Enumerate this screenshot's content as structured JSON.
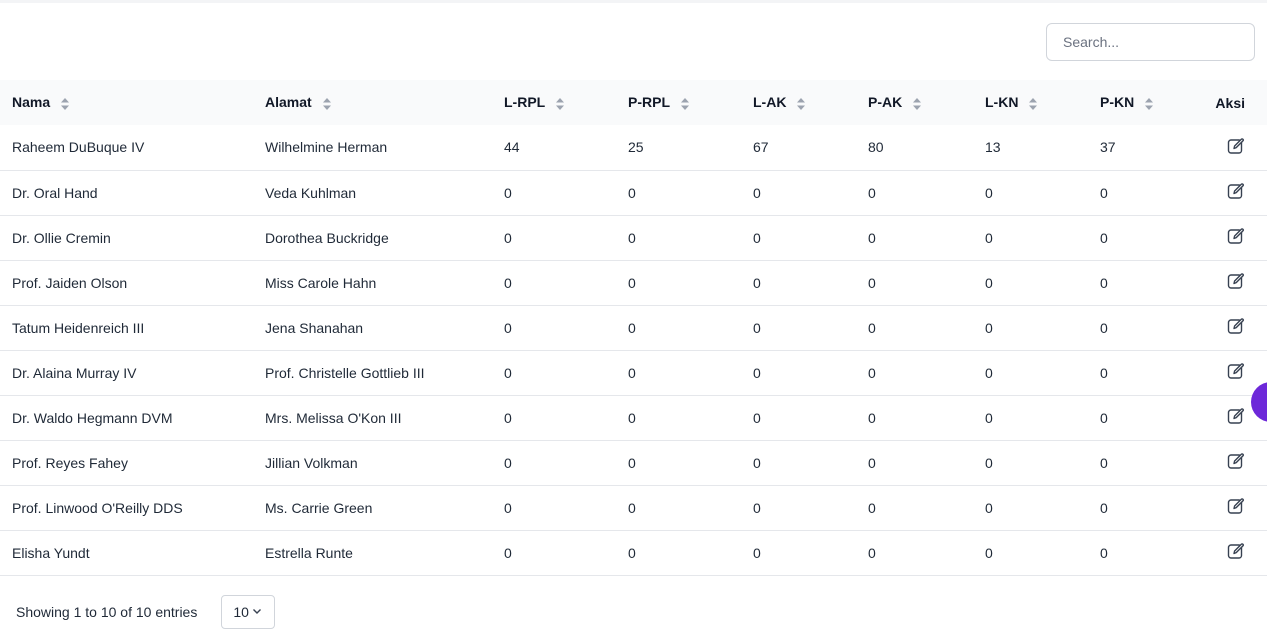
{
  "search": {
    "placeholder": "Search..."
  },
  "table": {
    "headers": [
      "Nama",
      "Alamat",
      "L-RPL",
      "P-RPL",
      "L-AK",
      "P-AK",
      "L-KN",
      "P-KN",
      "Aksi"
    ],
    "rows": [
      [
        "Raheem DuBuque IV",
        "Wilhelmine Herman",
        "44",
        "25",
        "67",
        "80",
        "13",
        "37"
      ],
      [
        "Dr. Oral Hand",
        "Veda Kuhlman",
        "0",
        "0",
        "0",
        "0",
        "0",
        "0"
      ],
      [
        "Dr. Ollie Cremin",
        "Dorothea Buckridge",
        "0",
        "0",
        "0",
        "0",
        "0",
        "0"
      ],
      [
        "Prof. Jaiden Olson",
        "Miss Carole Hahn",
        "0",
        "0",
        "0",
        "0",
        "0",
        "0"
      ],
      [
        "Tatum Heidenreich III",
        "Jena Shanahan",
        "0",
        "0",
        "0",
        "0",
        "0",
        "0"
      ],
      [
        "Dr. Alaina Murray IV",
        "Prof. Christelle Gottlieb III",
        "0",
        "0",
        "0",
        "0",
        "0",
        "0"
      ],
      [
        "Dr. Waldo Hegmann DVM",
        "Mrs. Melissa O'Kon III",
        "0",
        "0",
        "0",
        "0",
        "0",
        "0"
      ],
      [
        "Prof. Reyes Fahey",
        "Jillian Volkman",
        "0",
        "0",
        "0",
        "0",
        "0",
        "0"
      ],
      [
        "Prof. Linwood O'Reilly DDS",
        "Ms. Carrie Green",
        "0",
        "0",
        "0",
        "0",
        "0",
        "0"
      ],
      [
        "Elisha Yundt",
        "Estrella Runte",
        "0",
        "0",
        "0",
        "0",
        "0",
        "0"
      ]
    ]
  },
  "footer": {
    "entries_text": "Showing 1 to 10 of 10 entries",
    "page_size": "10"
  },
  "icons": {
    "edit": "edit-icon",
    "sort": "sort-icon",
    "chevron": "chevron-down-icon"
  },
  "colors": {
    "fab": "#6d28d9",
    "header_bg": "#f9fafb"
  }
}
